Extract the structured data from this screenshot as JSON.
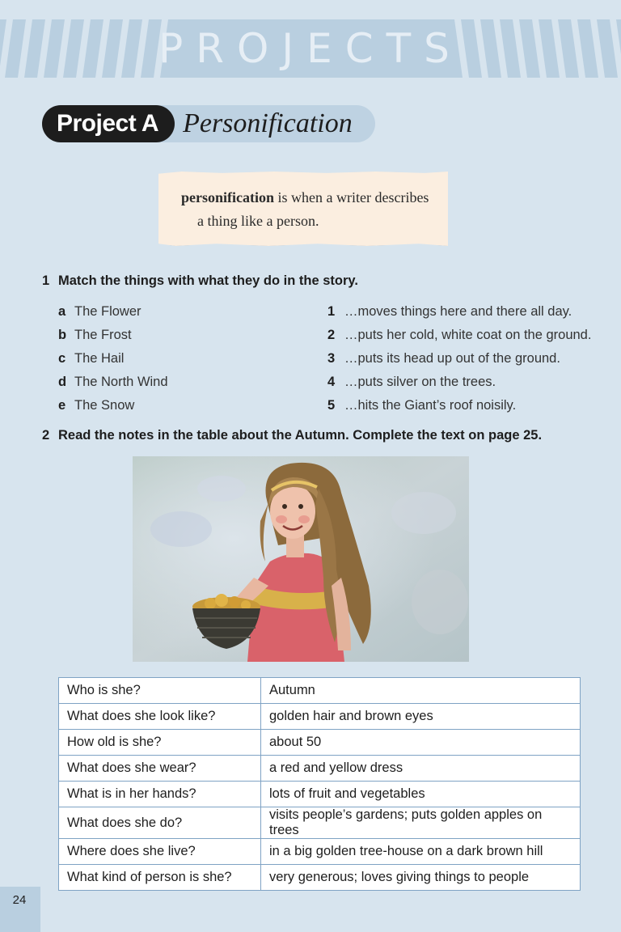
{
  "header": {
    "section_title": "PROJECTS"
  },
  "project": {
    "label": "Project A",
    "title": "Personification"
  },
  "definition": {
    "term": "personification",
    "line1_rest": " is when a writer describes",
    "line2": "a thing like a person."
  },
  "exercise1": {
    "number": "1",
    "instruction": "Match the things with what they do in the story.",
    "things": [
      {
        "letter": "a",
        "text": "The Flower"
      },
      {
        "letter": "b",
        "text": "The Frost"
      },
      {
        "letter": "c",
        "text": "The Hail"
      },
      {
        "letter": "d",
        "text": "The North Wind"
      },
      {
        "letter": "e",
        "text": "The Snow"
      }
    ],
    "actions": [
      {
        "number": "1",
        "text": "…moves things here and there all day."
      },
      {
        "number": "2",
        "text": "…puts her cold, white coat on the ground."
      },
      {
        "number": "3",
        "text": "…puts its head up out of the ground."
      },
      {
        "number": "4",
        "text": "…puts silver on the trees."
      },
      {
        "number": "5",
        "text": "…hits the Giant’s roof noisily."
      }
    ]
  },
  "exercise2": {
    "number": "2",
    "instruction": "Read the notes in the table about the Autumn. Complete the text on page 25."
  },
  "table": {
    "rows": [
      {
        "question": "Who is she?",
        "answer": "Autumn"
      },
      {
        "question": "What does she look like?",
        "answer": "golden hair and brown eyes"
      },
      {
        "question": "How old is she?",
        "answer": "about 50"
      },
      {
        "question": "What does she wear?",
        "answer": "a red and yellow dress"
      },
      {
        "question": "What is in her hands?",
        "answer": "lots of fruit and vegetables"
      },
      {
        "question": "What does she do?",
        "answer": "visits people’s gardens; puts golden apples on trees"
      },
      {
        "question": "Where does she live?",
        "answer": "in a big golden tree-house on a dark brown hill"
      },
      {
        "question": "What kind of person is she?",
        "answer": "very generous; loves giving things to people"
      }
    ]
  },
  "footer": {
    "page_number": "24"
  }
}
